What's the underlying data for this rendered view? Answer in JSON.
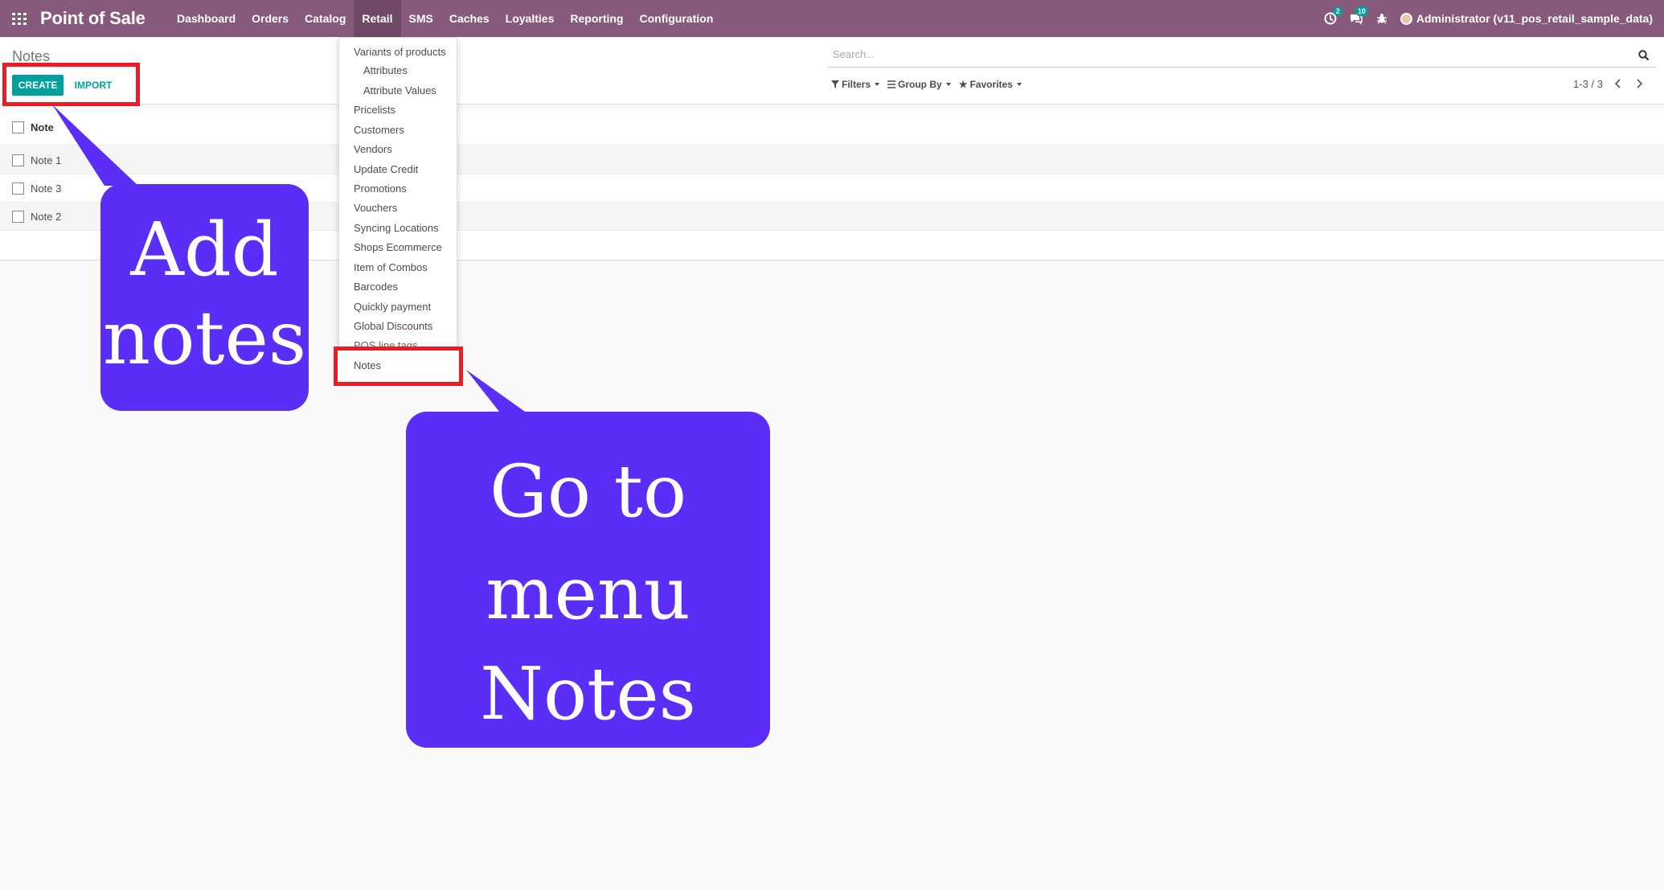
{
  "navbar": {
    "brand": "Point of Sale",
    "menu": [
      "Dashboard",
      "Orders",
      "Catalog",
      "Retail",
      "SMS",
      "Caches",
      "Loyalties",
      "Reporting",
      "Configuration"
    ],
    "active_menu": "Retail",
    "activity_badge": "2",
    "messages_badge": "10",
    "user": "Administrator (v11_pos_retail_sample_data)"
  },
  "control_panel": {
    "breadcrumb": "Notes",
    "create_label": "CREATE",
    "import_label": "IMPORT",
    "search_placeholder": "Search...",
    "filters_label": "Filters",
    "groupby_label": "Group By",
    "favorites_label": "Favorites",
    "pager": "1-3 / 3"
  },
  "list": {
    "header": "Note",
    "rows": [
      "Note 1",
      "Note 3",
      "Note 2"
    ]
  },
  "dropdown": {
    "items": [
      {
        "label": "Variants of products",
        "indent": false
      },
      {
        "label": "Attributes",
        "indent": true
      },
      {
        "label": "Attribute Values",
        "indent": true
      },
      {
        "label": "Pricelists",
        "indent": false
      },
      {
        "label": "Customers",
        "indent": false
      },
      {
        "label": "Vendors",
        "indent": false
      },
      {
        "label": "Update Credit",
        "indent": false
      },
      {
        "label": "Promotions",
        "indent": false
      },
      {
        "label": "Vouchers",
        "indent": false
      },
      {
        "label": "Syncing Locations",
        "indent": false
      },
      {
        "label": "Shops Ecommerce",
        "indent": false
      },
      {
        "label": "Item of Combos",
        "indent": false
      },
      {
        "label": "Barcodes",
        "indent": false
      },
      {
        "label": "Quickly payment",
        "indent": false
      },
      {
        "label": "Global Discounts",
        "indent": false
      },
      {
        "label": "POS line tags",
        "indent": false
      },
      {
        "label": "Notes",
        "indent": false
      }
    ]
  },
  "annotations": {
    "add_notes_line1": "Add",
    "add_notes_line2": "notes",
    "goto_line1": "Go to",
    "goto_line2": "menu",
    "goto_line3": "Notes",
    "callout_color": "#5a2ef7",
    "highlight_color": "#ec1c24"
  },
  "colors": {
    "navbar": "#875a7b",
    "primary_button": "#00a09d"
  }
}
